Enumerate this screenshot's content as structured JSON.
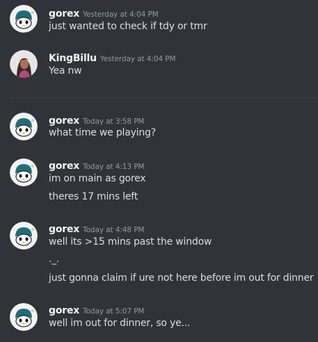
{
  "colors": {
    "background": "#313338",
    "username": "#f2f3f5",
    "text": "#dbdee1",
    "timestamp": "#949ba4",
    "divider": "#3f4147"
  },
  "messages": [
    {
      "author": "gorex",
      "timestamp": "Yesterday at 4:04 PM",
      "avatar_icon": "penguin-avatar-icon",
      "lines": [
        "just wanted to check if tdy or tmr"
      ]
    },
    {
      "author": "KingBillu",
      "timestamp": "Yesterday at 4:04 PM",
      "avatar_icon": "photo-avatar-icon",
      "lines": [
        "Yea nw"
      ]
    },
    {
      "author": "gorex",
      "timestamp": "Today at 3:58 PM",
      "avatar_icon": "penguin-avatar-icon",
      "lines": [
        "what time we playing?"
      ]
    },
    {
      "author": "gorex",
      "timestamp": "Today at 4:13 PM",
      "avatar_icon": "penguin-avatar-icon",
      "lines": [
        "im on main as gorex",
        "theres 17 mins left"
      ]
    },
    {
      "author": "gorex",
      "timestamp": "Today at 4:48 PM",
      "avatar_icon": "penguin-avatar-icon",
      "lines": [
        "well its >15 mins past the window",
        "._.",
        "just gonna claim if ure not here before im out for dinner"
      ]
    },
    {
      "author": "gorex",
      "timestamp": "Today at 5:07 PM",
      "avatar_icon": "penguin-avatar-icon",
      "lines": [
        "well im out for dinner, so ye..."
      ]
    }
  ]
}
